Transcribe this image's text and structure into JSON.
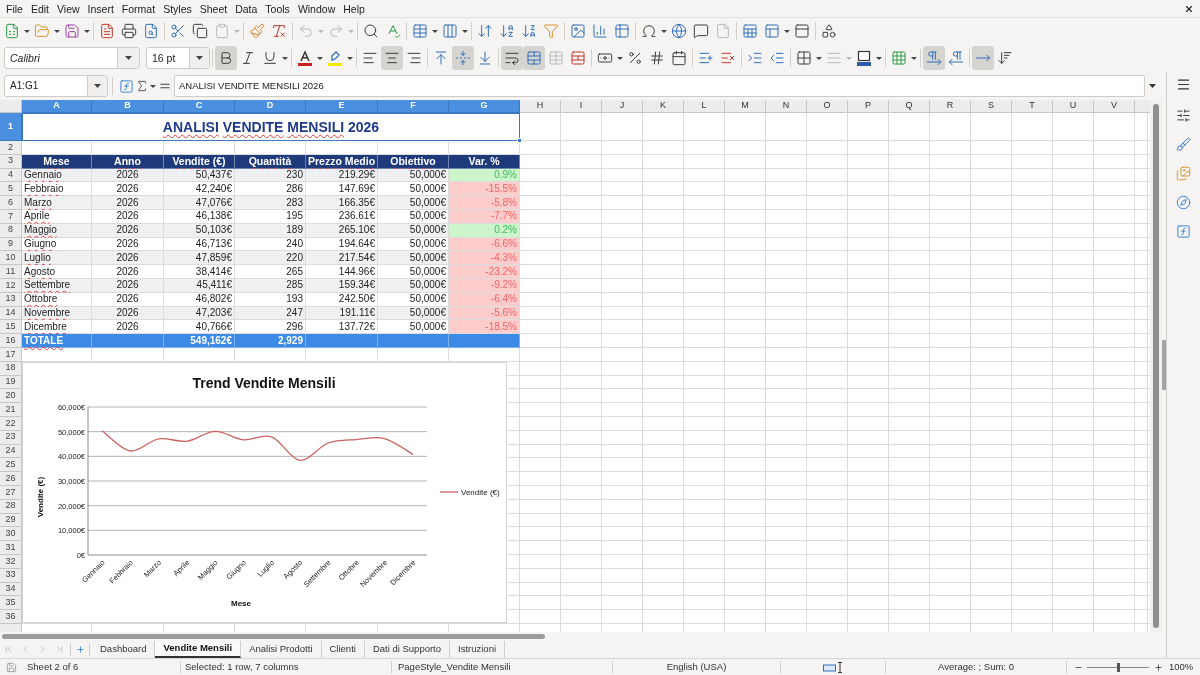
{
  "menu_bar": {
    "items": [
      "File",
      "Edit",
      "View",
      "Insert",
      "Format",
      "Styles",
      "Sheet",
      "Data",
      "Tools",
      "Window",
      "Help"
    ]
  },
  "standard_toolbar": {
    "disabled": {
      "paste": true,
      "undo": true,
      "redo": true,
      "document": true
    }
  },
  "formatting_toolbar": {
    "font_name": "Calibri",
    "font_size": "16 pt",
    "pressed": {
      "bold": true,
      "italic": false,
      "underline": false,
      "align_left": false,
      "align_center": true,
      "align_right": false,
      "align_top": false,
      "align_middle": true,
      "align_bottom": false,
      "wrap_text": true,
      "merge_and_center": true,
      "left_to_right": true,
      "right_to_left": false,
      "text_left_to_right": true,
      "text_top_to_bottom": false
    },
    "disabled": {
      "merge_cells": true,
      "border_style": true
    }
  },
  "formula_bar": {
    "name_box": "A1:G1",
    "content": "ANALISI VENDITE MENSILI 2026"
  },
  "sheet": {
    "spellcheck_underline": true,
    "column_headers": [
      {
        "label": "A",
        "selected": true
      },
      {
        "label": "B",
        "selected": true
      },
      {
        "label": "C",
        "selected": true
      },
      {
        "label": "D",
        "selected": true
      },
      {
        "label": "E",
        "selected": true
      },
      {
        "label": "F",
        "selected": true
      },
      {
        "label": "G",
        "selected": true
      },
      {
        "label": "H",
        "selected": false
      },
      {
        "label": "I",
        "selected": false
      },
      {
        "label": "J",
        "selected": false
      },
      {
        "label": "K",
        "selected": false
      },
      {
        "label": "L",
        "selected": false
      },
      {
        "label": "M",
        "selected": false
      },
      {
        "label": "N",
        "selected": false
      },
      {
        "label": "O",
        "selected": false
      },
      {
        "label": "P",
        "selected": false
      },
      {
        "label": "Q",
        "selected": false
      },
      {
        "label": "R",
        "selected": false
      },
      {
        "label": "S",
        "selected": false
      },
      {
        "label": "T",
        "selected": false
      },
      {
        "label": "U",
        "selected": false
      },
      {
        "label": "V",
        "selected": false
      }
    ],
    "row_headers": [
      {
        "label": "1",
        "selected": true
      },
      {
        "label": "2",
        "selected": false
      },
      {
        "label": "3",
        "selected": false
      },
      {
        "label": "4",
        "selected": false
      },
      {
        "label": "5",
        "selected": false
      },
      {
        "label": "6",
        "selected": false
      },
      {
        "label": "7",
        "selected": false
      },
      {
        "label": "8",
        "selected": false
      },
      {
        "label": "9",
        "selected": false
      },
      {
        "label": "10",
        "selected": false
      },
      {
        "label": "11",
        "selected": false
      },
      {
        "label": "12",
        "selected": false
      },
      {
        "label": "13",
        "selected": false
      },
      {
        "label": "14",
        "selected": false
      },
      {
        "label": "15",
        "selected": false
      },
      {
        "label": "16",
        "selected": false
      },
      {
        "label": "17",
        "selected": false
      },
      {
        "label": "18",
        "selected": false
      },
      {
        "label": "19",
        "selected": false
      },
      {
        "label": "20",
        "selected": false
      },
      {
        "label": "21",
        "selected": false
      },
      {
        "label": "22",
        "selected": false
      },
      {
        "label": "23",
        "selected": false
      },
      {
        "label": "24",
        "selected": false
      },
      {
        "label": "25",
        "selected": false
      },
      {
        "label": "26",
        "selected": false
      },
      {
        "label": "27",
        "selected": false
      },
      {
        "label": "28",
        "selected": false
      },
      {
        "label": "29",
        "selected": false
      },
      {
        "label": "30",
        "selected": false
      },
      {
        "label": "31",
        "selected": false
      },
      {
        "label": "32",
        "selected": false
      },
      {
        "label": "33",
        "selected": false
      },
      {
        "label": "34",
        "selected": false
      },
      {
        "label": "35",
        "selected": false
      },
      {
        "label": "36",
        "selected": false
      }
    ],
    "title": "ANALISI VENDITE MENSILI 2026",
    "header": [
      "Mese",
      "Anno",
      "Vendite (€)",
      "Quantità",
      "Prezzo Medio",
      "Obiettivo",
      "Var. %"
    ],
    "data": [
      {
        "month": "Gennaio",
        "year": "2026",
        "sales": "50,437€",
        "quantity": "230",
        "avg_price": "219.29€",
        "target": "50,000€",
        "change": {
          "value": "0.9%",
          "color": "#ccf5cc"
        }
      },
      {
        "month": "Febbraio",
        "year": "2026",
        "sales": "42,240€",
        "quantity": "286",
        "avg_price": "147.69€",
        "target": "50,000€",
        "change": {
          "value": "-15.5%",
          "color": "#ffcccc"
        }
      },
      {
        "month": "Marzo",
        "year": "2026",
        "sales": "47,076€",
        "quantity": "283",
        "avg_price": "166.35€",
        "target": "50,000€",
        "change": {
          "value": "-5.8%",
          "color": "#ffcccc"
        }
      },
      {
        "month": "Aprile",
        "year": "2026",
        "sales": "46,138€",
        "quantity": "195",
        "avg_price": "236.61€",
        "target": "50,000€",
        "change": {
          "value": "-7.7%",
          "color": "#ffcccc"
        }
      },
      {
        "month": "Maggio",
        "year": "2026",
        "sales": "50,103€",
        "quantity": "189",
        "avg_price": "265.10€",
        "target": "50,000€",
        "change": {
          "value": "0.2%",
          "color": "#ccf5cc"
        }
      },
      {
        "month": "Giugno",
        "year": "2026",
        "sales": "46,713€",
        "quantity": "240",
        "avg_price": "194.64€",
        "target": "50,000€",
        "change": {
          "value": "-6.6%",
          "color": "#ffcccc"
        }
      },
      {
        "month": "Luglio",
        "year": "2026",
        "sales": "47,859€",
        "quantity": "220",
        "avg_price": "217.54€",
        "target": "50,000€",
        "change": {
          "value": "-4.3%",
          "color": "#ffcccc"
        }
      },
      {
        "month": "Agosto",
        "year": "2026",
        "sales": "38,414€",
        "quantity": "265",
        "avg_price": "144.96€",
        "target": "50,000€",
        "change": {
          "value": "-23.2%",
          "color": "#ffcccc"
        }
      },
      {
        "month": "Settembre",
        "year": "2026",
        "sales": "45,411€",
        "quantity": "285",
        "avg_price": "159.34€",
        "target": "50,000€",
        "change": {
          "value": "-9.2%",
          "color": "#ffcccc"
        }
      },
      {
        "month": "Ottobre",
        "year": "2026",
        "sales": "46,802€",
        "quantity": "193",
        "avg_price": "242.50€",
        "target": "50,000€",
        "change": {
          "value": "-6.4%",
          "color": "#ffcccc"
        }
      },
      {
        "month": "Novembre",
        "year": "2026",
        "sales": "47,203€",
        "quantity": "247",
        "avg_price": "191.11€",
        "target": "50,000€",
        "change": {
          "value": "-5.6%",
          "color": "#ffcccc"
        }
      },
      {
        "month": "Dicembre",
        "year": "2026",
        "sales": "40,766€",
        "quantity": "296",
        "avg_price": "137.72€",
        "target": "50,000€",
        "change": {
          "value": "-18.5%",
          "color": "#ffcccc"
        }
      }
    ],
    "total": {
      "label": "TOTALE",
      "sales": "549,162€",
      "quantity": "2,929"
    },
    "chart": {
      "chart_data": {
        "type": "line",
        "title": "Trend Vendite Mensili",
        "xlabel": "Mese",
        "ylabel": "Vendite (€)",
        "grid": true,
        "categories": [
          "Gennaio",
          "Febbraio",
          "Marzo",
          "Aprile",
          "Maggio",
          "Giugno",
          "Luglio",
          "Agosto",
          "Settembre",
          "Ottobre",
          "Novembre",
          "Dicembre"
        ],
        "series": [
          {
            "name": "Vendite (€)",
            "color": "#c9625f",
            "values": [
              50400,
              42200,
              47100,
              46100,
              50100,
              46700,
              47900,
              38400,
              45400,
              46800,
              47200,
              40800
            ]
          }
        ],
        "ylim": [
          0,
          60000
        ],
        "yticks": [
          {
            "value": 0,
            "label": "0€"
          },
          {
            "value": 10000,
            "label": "10,000€"
          },
          {
            "value": 20000,
            "label": "20,000€"
          },
          {
            "value": 30000,
            "label": "30,000€"
          },
          {
            "value": 40000,
            "label": "40,000€"
          },
          {
            "value": 50000,
            "label": "50,000€"
          },
          {
            "value": 60000,
            "label": "60,000€"
          }
        ]
      }
    }
  },
  "sheet_tabs": {
    "navigation_disabled": true,
    "tabs": [
      {
        "label": "Dashboard",
        "selected": false
      },
      {
        "label": "Vendite Mensili",
        "selected": true
      },
      {
        "label": "Analisi Prodotti",
        "selected": false
      },
      {
        "label": "Clienti",
        "selected": false
      },
      {
        "label": "Dati di Supporto",
        "selected": false
      },
      {
        "label": "Istruzioni",
        "selected": false
      }
    ]
  },
  "status_bar": {
    "sheet": "Sheet 2 of 6",
    "selection": "Selected: 1 row, 7 columns",
    "page_style": "PageStyle_Vendite Mensili",
    "language": "English (USA)",
    "sum": "Average: ; Sum: 0",
    "zoom_slider": {
      "level": 0.5
    },
    "zoom": "100%"
  }
}
